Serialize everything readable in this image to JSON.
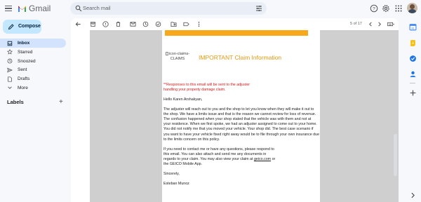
{
  "app": {
    "name": "Gmail"
  },
  "search": {
    "placeholder": "Search mail"
  },
  "compose": {
    "label": "Compose"
  },
  "nav": [
    {
      "label": "Inbox",
      "icon": "inbox-icon",
      "active": true
    },
    {
      "label": "Starred",
      "icon": "star-icon"
    },
    {
      "label": "Snoozed",
      "icon": "clock-icon"
    },
    {
      "label": "Sent",
      "icon": "send-icon"
    },
    {
      "label": "Drafts",
      "icon": "draft-icon"
    },
    {
      "label": "More",
      "icon": "chevron-down-icon"
    }
  ],
  "labels": {
    "heading": "Labels",
    "add": "+"
  },
  "toolbar": {
    "page_count": "5 of 17"
  },
  "email": {
    "logo_alt": "icon-claims-CLAIMS",
    "title": "IMPORTANT Claim Information",
    "notice": "**Responses to this email will be sent to the adjuster handling your property damage claim.",
    "greeting": "Hello Karen Arshakyan,",
    "paragraph1": "The adjuster will reach out to you and the shop to let you know when they will make it out to the shop. We have a limits issue and that is the reason we cannot review for loss of revenue. The confusion happened when your shop stated that the vehicle was with them and not at your residence. When we first spoke, we had an adjuster assigned to come out to your home. You did not notify me that you moved your vehicle. Your shop did. The best case scenario if you want to have your vehicle fixed right away would be to file through your own insurance due to the limits concern on this policy.",
    "paragraph2_a": "If you need to contact me or have any questions, please respond to this email. You can also attach and send me any documents in regards to your claim. You may also view your claim at ",
    "paragraph2_link": "geico.com",
    "paragraph2_b": " or the GEICO Mobile App.",
    "closing": "Sincerely,",
    "signature": "Esteban Munoz"
  },
  "colors": {
    "accent_orange": "#f7a91b",
    "title_orange": "#e39a0e",
    "notice_red": "#d3191c",
    "compose_bg": "#c2e7ff",
    "active_nav": "#d3e3fd"
  }
}
